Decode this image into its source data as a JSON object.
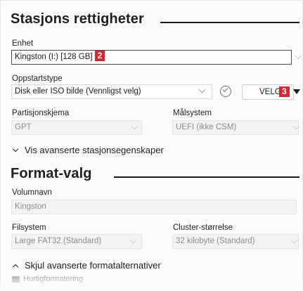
{
  "drive_properties": {
    "title": "Stasjons rettigheter",
    "device_label": "Enhet",
    "device_value": "Kingston (I:) [128 GB]",
    "device_badge": "2",
    "boot_label": "Oppstartstype",
    "boot_value": "Disk eller ISO bilde (Vennligst velg)",
    "select_button_label": "VELG",
    "select_button_badge": "3",
    "partition_label": "Partisjonskjema",
    "partition_value": "GPT",
    "target_label": "Målsystem",
    "target_value": "UEFI (ikke CSM)",
    "advanced_toggle": "Vis avanserte stasjonsegenskaper"
  },
  "format_options": {
    "title": "Format-valg",
    "volume_label": "Volumnavn",
    "volume_value": "Kingston",
    "filesystem_label": "Filsystem",
    "filesystem_value": "Large FAT32 (Standard)",
    "cluster_label": "Cluster-størrelse",
    "cluster_value": "32 kilobyte (Standard)",
    "advanced_toggle": "Skjul avanserte formatalternativer",
    "quick_format_label": "Hurtigformatering"
  },
  "colors": {
    "badge": "#d9262e",
    "disabled_text": "#8b8b8b"
  },
  "icons": [
    "check-circle-icon",
    "dropdown-chevron-icon",
    "dropdown-triangle-icon",
    "caret-down-icon",
    "caret-up-icon"
  ]
}
